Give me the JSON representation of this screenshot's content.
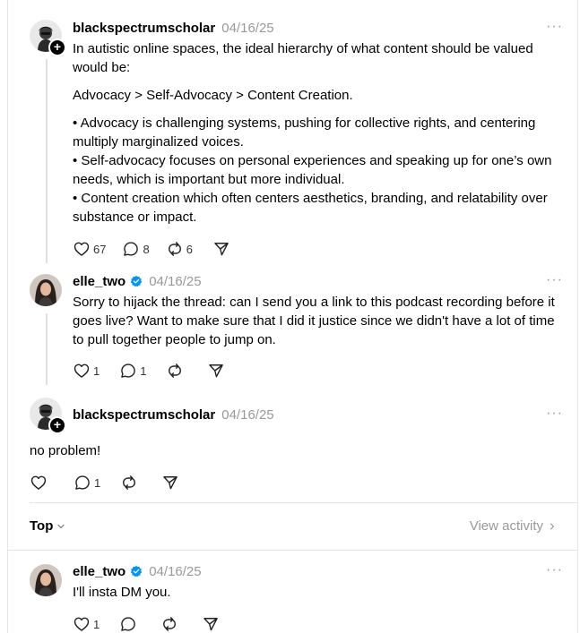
{
  "posts": [
    {
      "username": "blackspectrumscholar",
      "date": "04/16/25",
      "verified": false,
      "paragraphs": [
        "In autistic online spaces, the ideal hierarchy of what content should be valued would be:",
        "Advocacy > Self-Advocacy > Content Creation.",
        "• Advocacy is challenging systems, pushing for collective rights, and centering multiply marginalized voices.\n• Self-advocacy focuses on personal experiences and speaking up for one’s own needs, which is important but more individual.\n• Content creation which often centers aesthetics, branding, and relatability over substance or impact."
      ],
      "likes": "67",
      "replies": "8",
      "reposts": "6"
    },
    {
      "username": "elle_two",
      "date": "04/16/25",
      "verified": true,
      "text": "Sorry to hijack the thread: can I send you a link to this podcast recording before it goes live? Want to make sure that I did it justice since we didn't have a lot of time to pull together people to jump on.",
      "likes": "1",
      "replies": "1",
      "reposts": ""
    },
    {
      "username": "blackspectrumscholar",
      "date": "04/16/25",
      "verified": false,
      "text": "no problem!",
      "likes": "",
      "replies": "1",
      "reposts": ""
    },
    {
      "username": "elle_two",
      "date": "04/16/25",
      "verified": true,
      "text": "I'll insta DM you.",
      "likes": "1",
      "replies": "",
      "reposts": ""
    }
  ],
  "sort_label": "Top",
  "view_activity_label": "View activity",
  "more_label": "···",
  "colors": {
    "verified": "#0095f6",
    "muted": "#999999",
    "divider": "#e5e5e5"
  },
  "icons": [
    "heart-icon",
    "comment-icon",
    "repost-icon",
    "share-icon",
    "verified-badge-icon",
    "chevron-down-icon",
    "chevron-right-icon",
    "more-icon"
  ]
}
